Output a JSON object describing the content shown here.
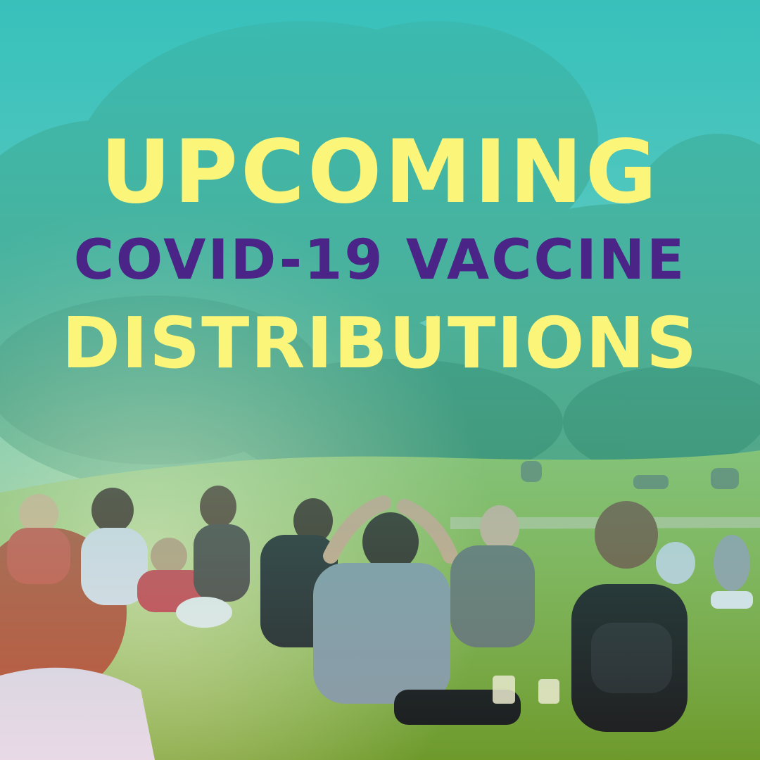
{
  "headline": {
    "line1": "UPCOMING",
    "line2": "COVID-19 VACCINE",
    "line3": "DISTRIBUTIONS"
  },
  "colors": {
    "overlay_top": "#3ec3bd",
    "headline_yellow": "#fbf57a",
    "headline_purple": "#4a2487",
    "grass": "#7fae3a"
  },
  "scene": "park-crowd-photo"
}
